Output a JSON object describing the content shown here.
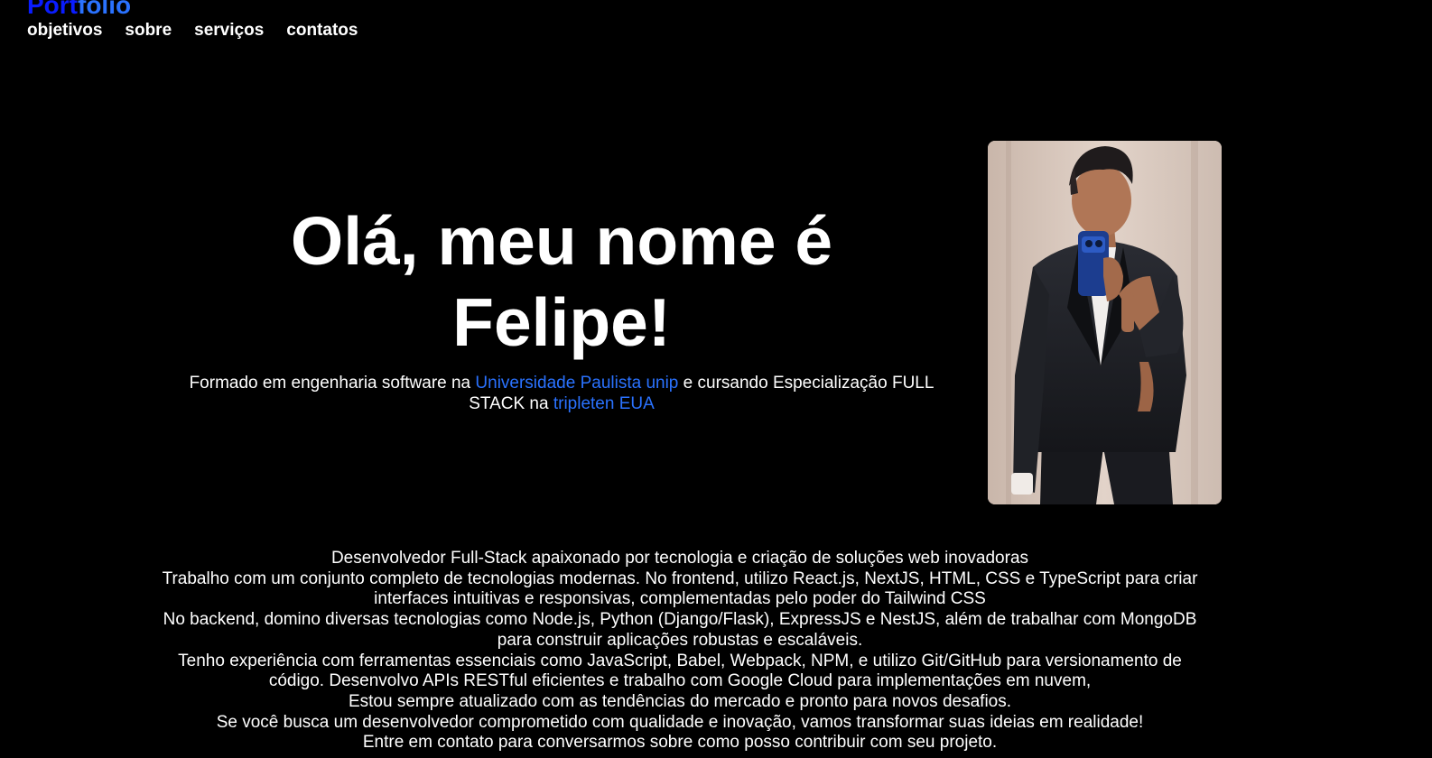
{
  "header": {
    "logo_part1": "Port",
    "logo_part2": "folio",
    "nav": [
      "objetivos",
      "sobre",
      "serviços",
      "contatos"
    ]
  },
  "hero": {
    "title": "Olá, meu nome é Felipe!",
    "subtitle_prefix": "Formado em engenharia software na ",
    "university_link": "Universidade Paulista unip",
    "subtitle_middle": " e cursando Especialização FULL STACK na ",
    "course_link": "tripleten EUA",
    "photo_alt": "profile photo"
  },
  "about": {
    "lines": [
      "Desenvolvedor Full-Stack apaixonado por tecnologia e criação de soluções web inovadoras",
      "Trabalho com um conjunto completo de tecnologias modernas. No frontend, utilizo React.js, NextJS, HTML, CSS e TypeScript para criar interfaces intuitivas e responsivas, complementadas pelo poder do Tailwind CSS",
      "No backend, domino diversas tecnologias como Node.js, Python (Django/Flask), ExpressJS e NestJS, além de trabalhar com MongoDB para construir aplicações robustas e escaláveis.",
      "Tenho experiência com ferramentas essenciais como JavaScript, Babel, Webpack, NPM, e utilizo Git/GitHub para versionamento de código. Desenvolvo APIs RESTful eficientes e trabalho com Google Cloud para implementações em nuvem,",
      "Estou sempre atualizado com as tendências do mercado e pronto para novos desafios.",
      "Se você busca um desenvolvedor comprometido com qualidade e inovação, vamos transformar suas ideias em realidade!",
      "Entre em contato para conversarmos sobre como posso contribuir com seu projeto."
    ]
  },
  "colors": {
    "background": "#000000",
    "text": "#ffffff",
    "link": "#2a72ff",
    "logo_primary": "#0a1cff"
  }
}
